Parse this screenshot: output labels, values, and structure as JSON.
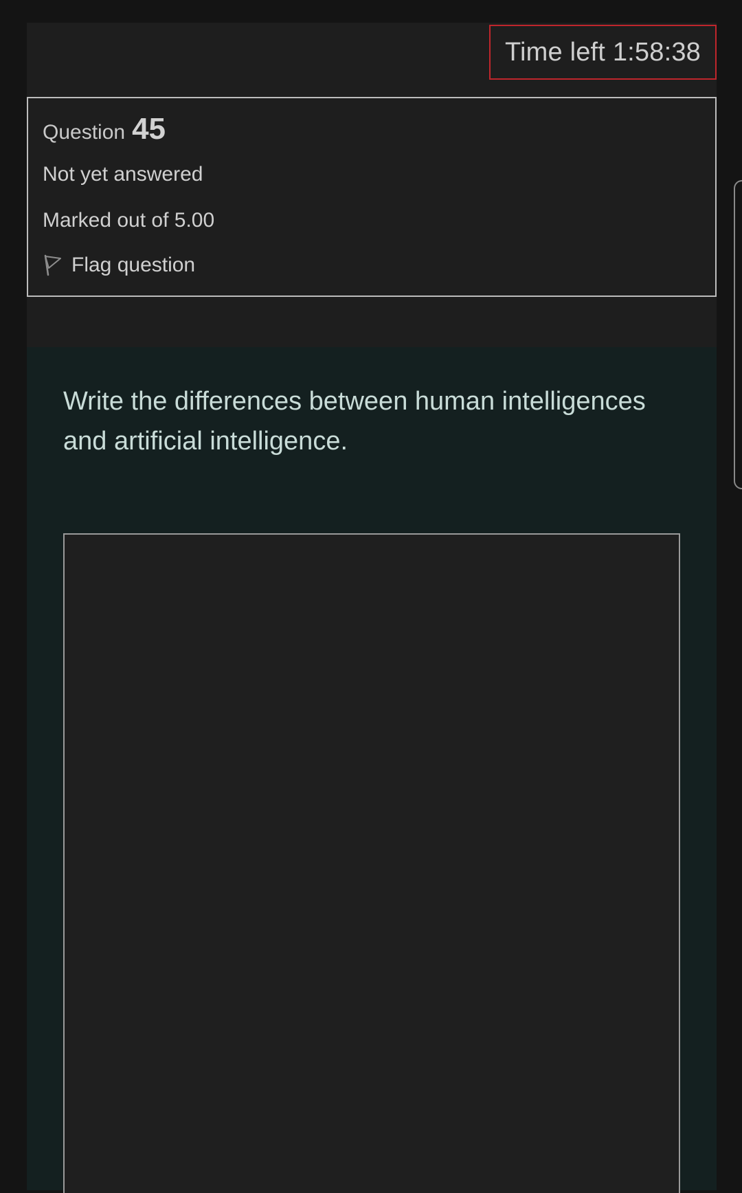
{
  "timer": {
    "label": "Time left 1:58:38"
  },
  "question_info": {
    "prefix": "Question",
    "number": "45",
    "status": "Not yet answered",
    "marks": "Marked out of 5.00",
    "flag_label": "Flag question"
  },
  "question": {
    "text": "Write the differences between human intelligences and artificial intelligence.",
    "answer_value": ""
  },
  "colors": {
    "page_bg": "#141414",
    "panel_bg": "#1e1e1e",
    "formulation_bg": "#142020",
    "timer_border": "#c0262c",
    "text": "#d0d0d0"
  },
  "icons": [
    "flag-icon"
  ]
}
